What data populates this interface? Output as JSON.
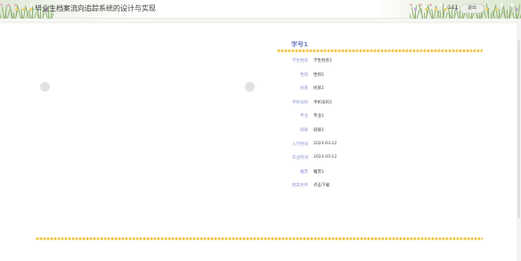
{
  "header": {
    "title": "毕业生档案流向追踪系统的设计与实现",
    "user_name": "111",
    "user_button_label": "退出"
  },
  "detail": {
    "heading": "学号1",
    "fields": [
      {
        "label": "学生姓名",
        "value": "学生姓名1"
      },
      {
        "label": "性别",
        "value": "性别1"
      },
      {
        "label": "民族",
        "value": "民族1"
      },
      {
        "label": "手机号码",
        "value": "手机号码1"
      },
      {
        "label": "专业",
        "value": "专业1"
      },
      {
        "label": "班级",
        "value": "班级1"
      },
      {
        "label": "入学时间",
        "value": "2023-03-12"
      },
      {
        "label": "毕业时间",
        "value": "2023-03-12"
      },
      {
        "label": "籍贯",
        "value": "籍贯1"
      },
      {
        "label": "档案文件",
        "value": "点击下载"
      }
    ]
  },
  "colors": {
    "accent": "#7a86c4",
    "divider": "#f1c23a"
  },
  "icons": {
    "carousel_prev": "chevron-left-icon",
    "carousel_next": "chevron-right-icon"
  }
}
